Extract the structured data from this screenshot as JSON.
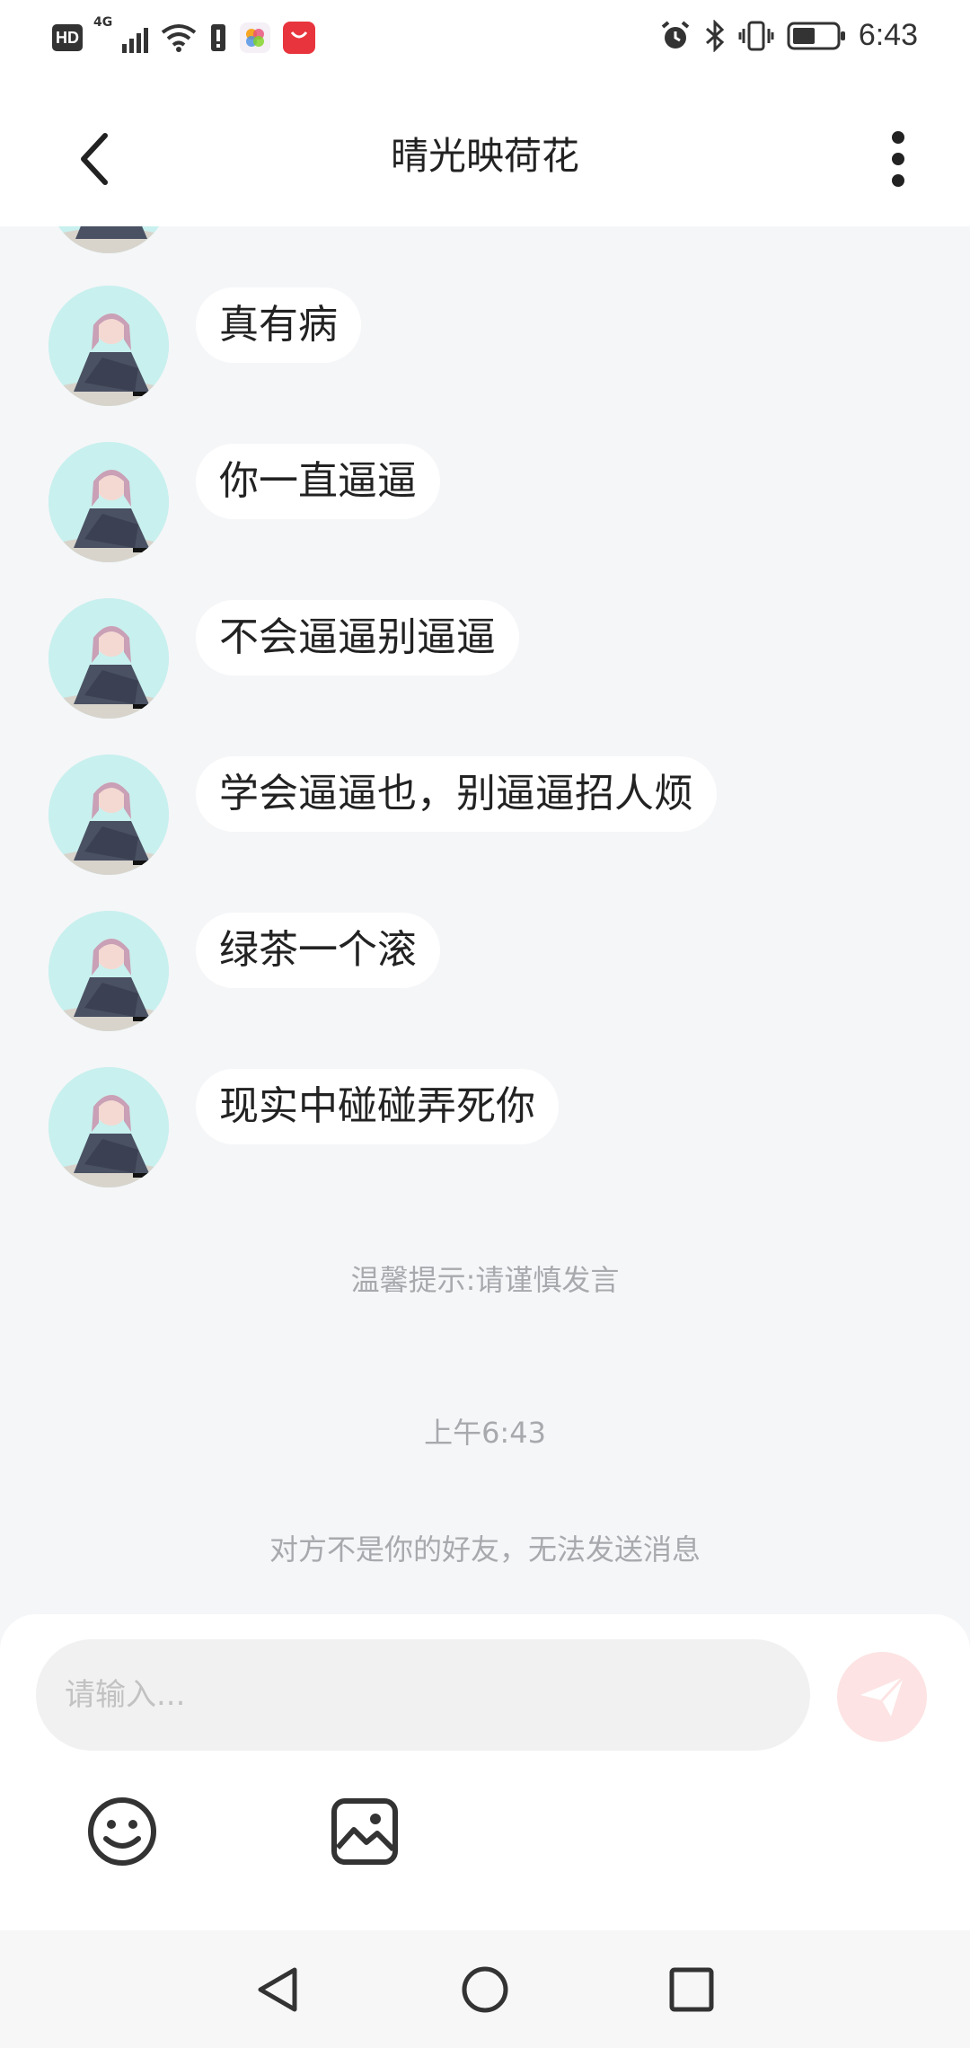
{
  "status_bar": {
    "hd_label": "HD",
    "network_label": "4G",
    "time": "6:43"
  },
  "header": {
    "title": "晴光映荷花"
  },
  "messages": [
    {
      "text": "真有病"
    },
    {
      "text": "你一直逼逼"
    },
    {
      "text": "不会逼逼别逼逼"
    },
    {
      "text": "学会逼逼也，别逼逼招人烦"
    },
    {
      "text": "绿茶一个滚"
    },
    {
      "text": "现实中碰碰弄死你"
    }
  ],
  "notices": {
    "warning": "温馨提示:请谨慎发言",
    "timestamp": "上午6:43",
    "not_friend": "对方不是你的好友，无法发送消息"
  },
  "input": {
    "placeholder": "请输入..."
  },
  "colors": {
    "background": "#f5f6f8",
    "bubble": "#ffffff",
    "send_button": "#fde3e3",
    "notice_text": "#a7a9ad"
  }
}
